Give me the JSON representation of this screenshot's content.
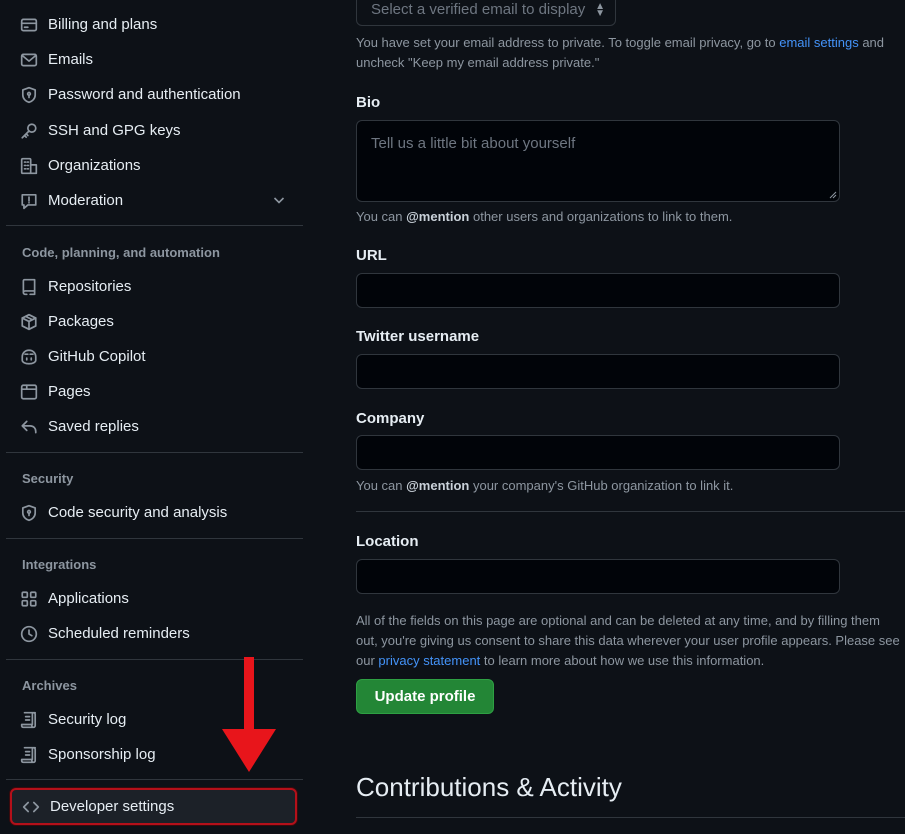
{
  "sidebar": {
    "items_top": [
      {
        "label": "Billing and plans",
        "icon": "credit-card-icon"
      },
      {
        "label": "Emails",
        "icon": "mail-icon"
      },
      {
        "label": "Password and authentication",
        "icon": "shield-lock-icon"
      },
      {
        "label": "SSH and GPG keys",
        "icon": "key-icon"
      },
      {
        "label": "Organizations",
        "icon": "organization-icon"
      },
      {
        "label": "Moderation",
        "icon": "report-icon"
      }
    ],
    "section_code": "Code, planning, and automation",
    "items_code": [
      {
        "label": "Repositories",
        "icon": "repo-icon"
      },
      {
        "label": "Packages",
        "icon": "package-icon"
      },
      {
        "label": "GitHub Copilot",
        "icon": "copilot-icon"
      },
      {
        "label": "Pages",
        "icon": "browser-icon"
      },
      {
        "label": "Saved replies",
        "icon": "reply-icon"
      }
    ],
    "section_security": "Security",
    "items_security": [
      {
        "label": "Code security and analysis",
        "icon": "shield-lock-icon"
      }
    ],
    "section_integrations": "Integrations",
    "items_integrations": [
      {
        "label": "Applications",
        "icon": "apps-icon"
      },
      {
        "label": "Scheduled reminders",
        "icon": "clock-icon"
      }
    ],
    "section_archives": "Archives",
    "items_archives": [
      {
        "label": "Security log",
        "icon": "log-icon"
      },
      {
        "label": "Sponsorship log",
        "icon": "log-icon"
      }
    ],
    "developer_settings": "Developer settings"
  },
  "profile": {
    "email_select_placeholder": "Select a verified email to display",
    "email_note_1": "You have set your email address to private. To toggle email privacy, go to ",
    "email_note_link": "email settings",
    "email_note_2": " and",
    "email_note_3": "uncheck \"Keep my email address private.\"",
    "bio_label": "Bio",
    "bio_placeholder": "Tell us a little bit about yourself",
    "bio_note_1": "You can ",
    "bio_note_mention": "@mention",
    "bio_note_2": " other users and organizations to link to them.",
    "url_label": "URL",
    "twitter_label": "Twitter username",
    "company_label": "Company",
    "company_note_1": "You can ",
    "company_note_mention": "@mention",
    "company_note_2": " your company's GitHub organization to link it.",
    "location_label": "Location",
    "privacy_note_1": "All of the fields on this page are optional and can be deleted at any time, and by filling them",
    "privacy_note_2": "out, you're giving us consent to share this data wherever your user profile appears. Please see",
    "privacy_note_3a": "our ",
    "privacy_note_link": "privacy statement",
    "privacy_note_3b": " to learn more about how we use this information.",
    "update_button": "Update profile",
    "contributions_heading": "Contributions & Activity"
  },
  "colors": {
    "background": "#0d1117",
    "link": "#4493f8",
    "primary_button": "#238636",
    "highlight_border": "#b4101a",
    "annotation_arrow": "#e8151b"
  }
}
